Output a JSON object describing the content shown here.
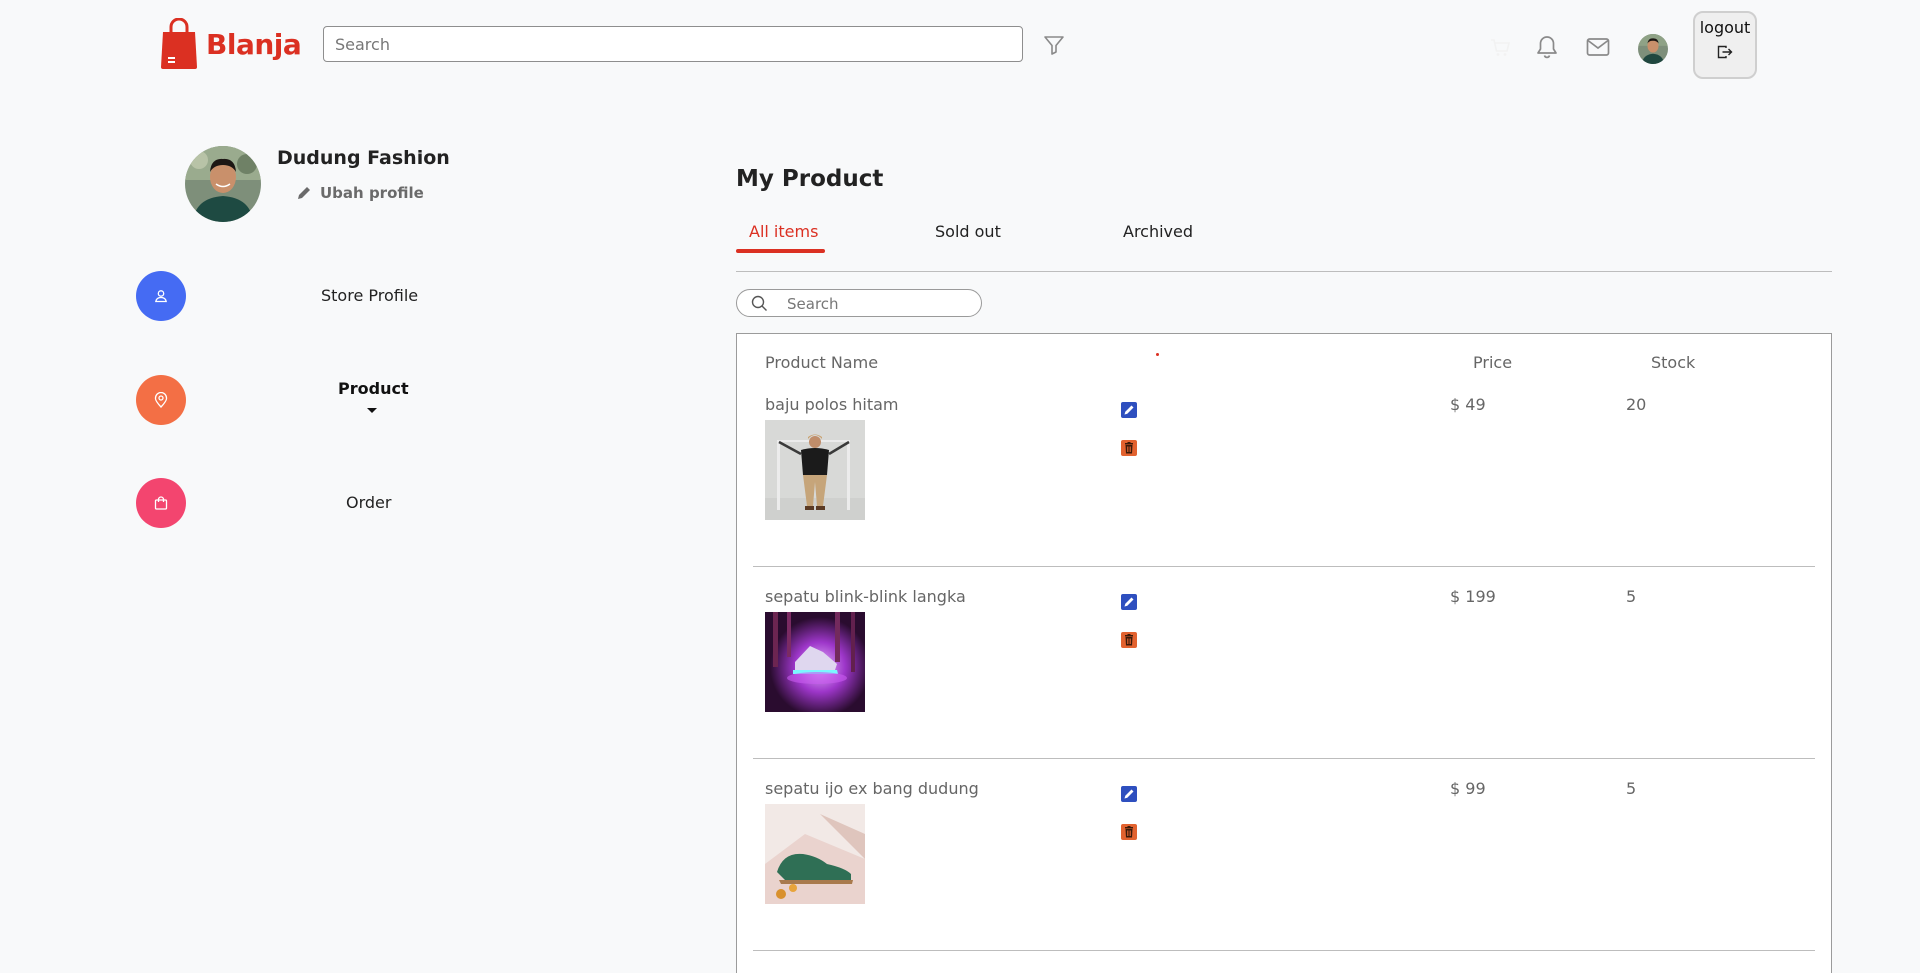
{
  "header": {
    "brand": "Blanja",
    "search_placeholder": "Search",
    "logout_label": "logout"
  },
  "sidebar": {
    "store_name": "Dudung Fashion",
    "edit_profile_label": "Ubah profile",
    "items": [
      {
        "label": "Store Profile",
        "color": "#456bf3",
        "icon": "user-icon"
      },
      {
        "label": "Product",
        "color": "#f36f45",
        "icon": "location-pin-icon"
      },
      {
        "label": "Order",
        "color": "#f3456f",
        "icon": "shopping-bag-icon"
      }
    ]
  },
  "main": {
    "title": "My Product",
    "tabs": [
      "All items",
      "Sold out",
      "Archived"
    ],
    "active_tab": "All items",
    "search_placeholder": "Search",
    "columns": {
      "name": "Product Name",
      "price": "Price",
      "stock": "Stock"
    },
    "products": [
      {
        "name": "baju polos hitam",
        "price": "$ 49",
        "stock": "20"
      },
      {
        "name": "sepatu blink-blink langka",
        "price": "$ 199",
        "stock": "5"
      },
      {
        "name": "sepatu ijo ex bang dudung",
        "price": "$ 99",
        "stock": "5"
      }
    ]
  },
  "colors": {
    "brand": "#db3022",
    "edit_icon": "#2e4fbf",
    "delete_icon": "#e2622f"
  }
}
